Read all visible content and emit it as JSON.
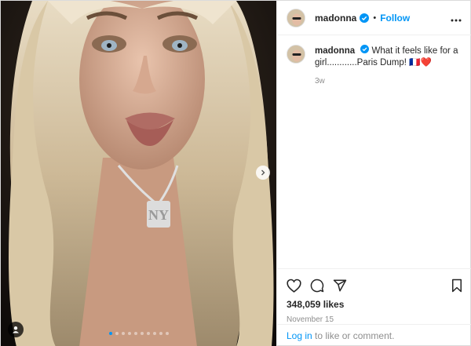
{
  "post": {
    "username": "madonna",
    "follow_label": "Follow",
    "separator": "•",
    "caption_user": "madonna",
    "caption_text": "What it feels like for a girl............Paris Dump! 🇫🇷❤️",
    "caption_age": "3w",
    "likes_text": "348,059 likes",
    "date_text": "November 15",
    "login_link": "Log in",
    "login_rest": " to like or comment."
  },
  "carousel": {
    "slide_count": 10,
    "active_index": 0
  },
  "icons": {
    "verified": "verified-badge-icon",
    "more": "more-options-icon",
    "like": "heart-icon",
    "comment": "comment-icon",
    "share": "share-icon",
    "save": "bookmark-icon",
    "next": "chevron-right-icon",
    "tag": "user-tag-icon"
  },
  "colors": {
    "accent": "#0095f6",
    "text": "#262626",
    "muted": "#8e8e8e"
  }
}
